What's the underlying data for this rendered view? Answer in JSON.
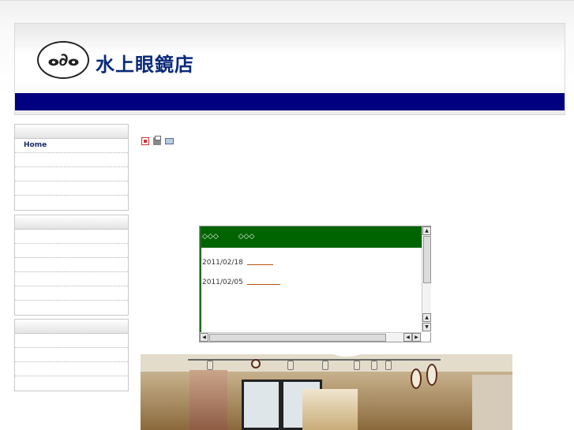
{
  "header": {
    "logo_mark": "ⴰ∂ⴰ",
    "shop_name": "水上眼鏡店",
    "accent_color": "#000080"
  },
  "sidebar": {
    "menu1": {
      "items": [
        "Home",
        "",
        "",
        "",
        ""
      ]
    },
    "menu2": {
      "items": [
        "",
        "",
        "",
        "",
        "",
        ""
      ]
    },
    "menu3": {
      "items": [
        "",
        "",
        "",
        ""
      ]
    }
  },
  "toolbar": {
    "icons": [
      "pdf-icon",
      "print-icon",
      "email-icon"
    ]
  },
  "news": {
    "header_cols": [
      "◇◇◇",
      "◇◇◇"
    ],
    "header_color": "#006400",
    "items": [
      {
        "date": "2011/02/18"
      },
      {
        "date": "2011/02/05"
      }
    ],
    "link_color": "#b8530c"
  },
  "scrollbars": {
    "up_arrow": "▲",
    "down_arrow": "▼",
    "left_arrow": "◀",
    "right_arrow": "▶"
  }
}
